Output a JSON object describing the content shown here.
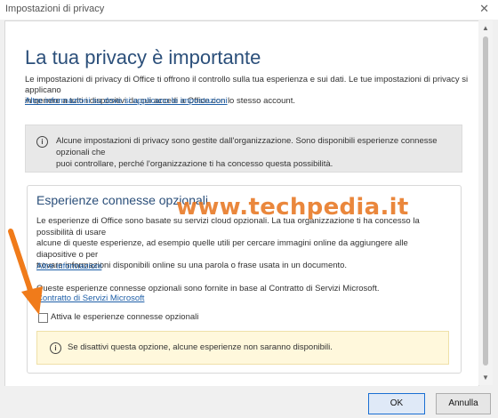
{
  "window": {
    "title": "Impostazioni di privacy",
    "close_glyph": "✕"
  },
  "main": {
    "heading": "La tua privacy è importante",
    "intro_line1": "Le impostazioni di privacy di Office ti offrono il controllo sulla tua esperienza e sui dati. Le tue impostazioni di privacy si applicano",
    "intro_line2": "in genere a tutti i dispositivi da cui accedi a Office con lo stesso account.",
    "intro_link": "Altre informazioni su dove si applicano le impostazioni"
  },
  "org_notice": {
    "icon": "info-icon",
    "text_line1": "Alcune impostazioni di privacy sono gestite dall'organizzazione. Sono disponibili esperienze connesse opzionali che",
    "text_line2": "puoi controllare, perché l'organizzazione ti ha concesso questa possibilità."
  },
  "optional_section": {
    "title": "Esperienze connesse opzionali",
    "desc_line1": "Le esperienze di Office sono basate su servizi cloud opzionali. La tua organizzazione ti ha concesso la possibilità di usare",
    "desc_line2": "alcune di queste esperienze, ad esempio quelle utili per cercare immagini online da aggiungere alle diapositive o per",
    "desc_line3": "trovare informazioni disponibili online su una parola o frase usata in un documento.",
    "more_link": "Altre informazioni",
    "contract_text": "Queste esperienze connesse opzionali sono fornite in base al Contratto di Servizi Microsoft.",
    "contract_link": "Contratto di Servizi Microsoft",
    "checkbox_label": "Attiva le esperienze connesse opzionali",
    "checkbox_checked": false,
    "warning_icon": "info-icon",
    "warning_text": "Se disattivi questa opzione, alcune esperienze non saranno disponibili."
  },
  "watermark": "www.techpedia.it",
  "buttons": {
    "ok": "OK",
    "cancel": "Annulla"
  },
  "colors": {
    "heading": "#2b4f7a",
    "link": "#1e5fa8",
    "accent": "#1a6fd3",
    "warning_bg": "#fff8dc",
    "watermark": "#e87722"
  }
}
